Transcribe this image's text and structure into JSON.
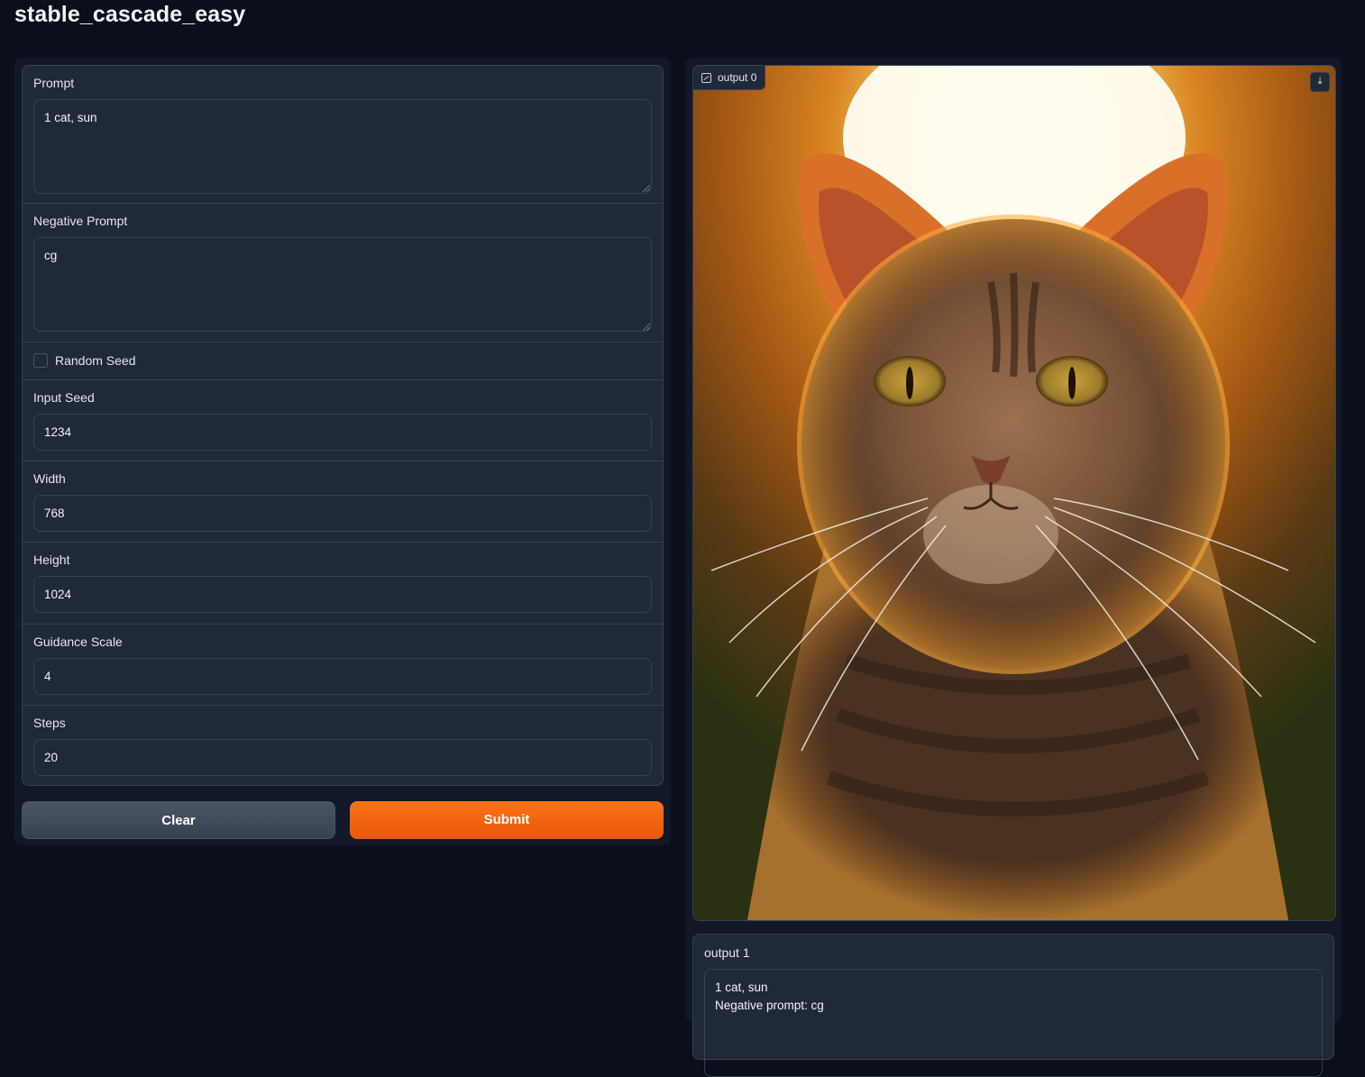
{
  "app": {
    "title": "stable_cascade_easy"
  },
  "form": {
    "prompt": {
      "label": "Prompt",
      "value": "1 cat, sun"
    },
    "negative_prompt": {
      "label": "Negative Prompt",
      "value": "cg"
    },
    "random_seed": {
      "label": "Random Seed",
      "checked": false
    },
    "input_seed": {
      "label": "Input Seed",
      "value": "1234"
    },
    "width": {
      "label": "Width",
      "value": "768"
    },
    "height": {
      "label": "Height",
      "value": "1024"
    },
    "guidance_scale": {
      "label": "Guidance Scale",
      "value": "4"
    },
    "steps": {
      "label": "Steps",
      "value": "20"
    }
  },
  "buttons": {
    "clear": "Clear",
    "submit": "Submit"
  },
  "output0": {
    "label": "output 0",
    "image": "cat-sunset-portrait",
    "download_icon": "download-icon"
  },
  "output1": {
    "label": "output 1",
    "line1": "1 cat, sun",
    "line2": "Negative prompt: cg"
  },
  "colors": {
    "background": "#0b0f19",
    "panel": "#1f2937",
    "accent": "#f97316",
    "secondary": "#4b5563"
  }
}
